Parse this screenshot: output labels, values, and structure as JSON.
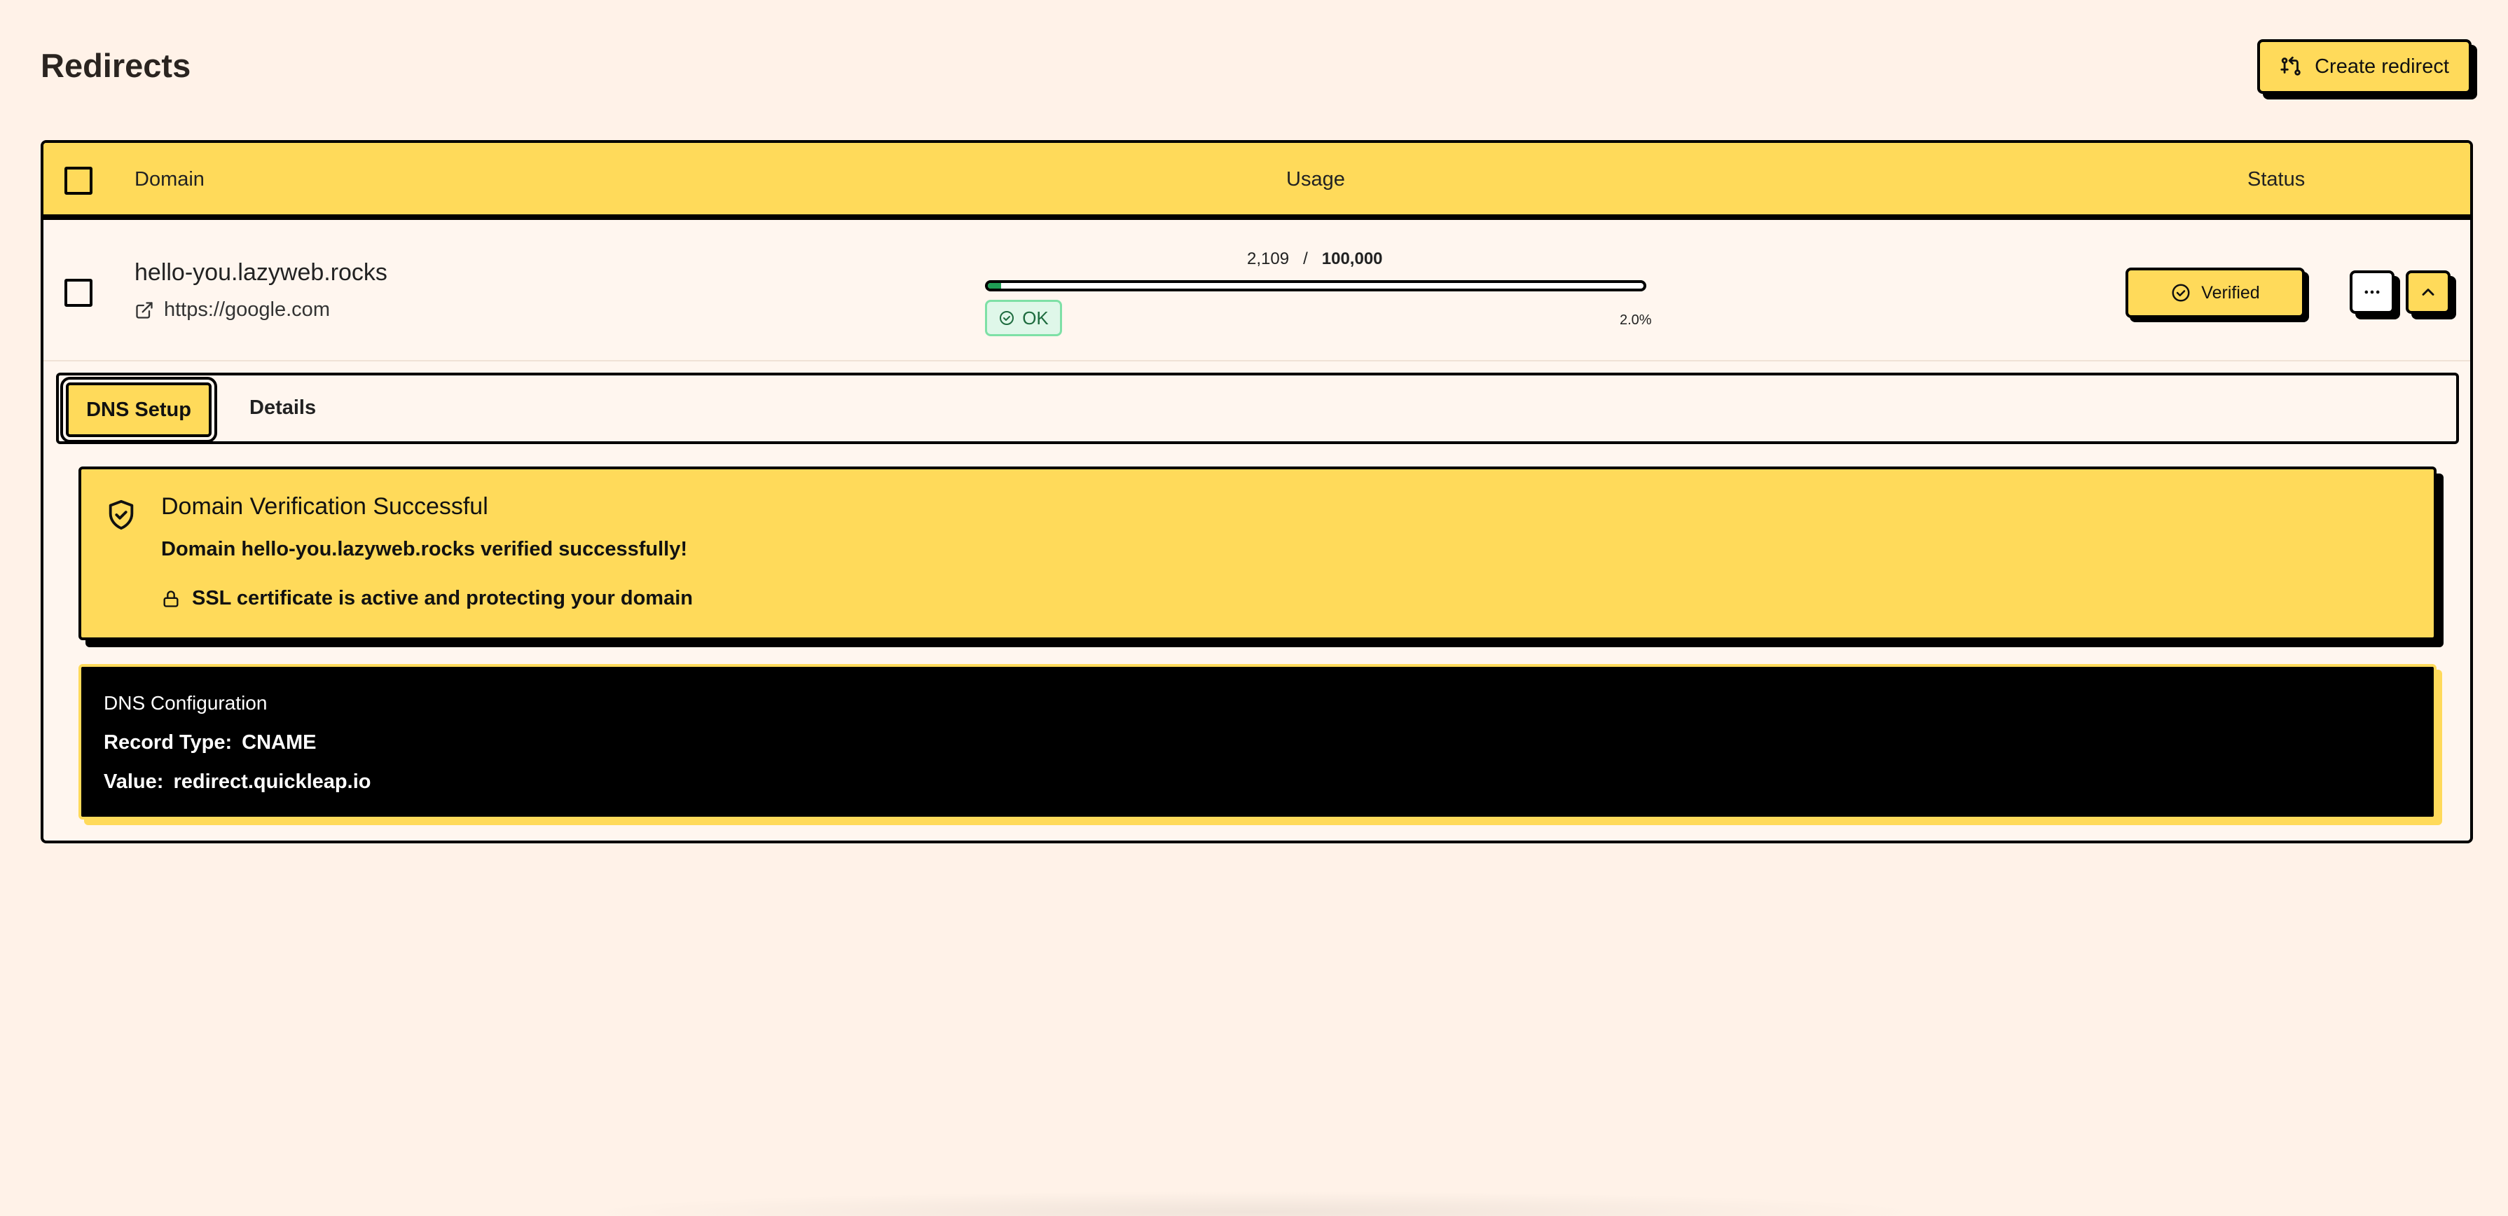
{
  "page": {
    "title": "Redirects"
  },
  "header": {
    "create_button_label": "Create redirect"
  },
  "table": {
    "columns": {
      "domain": "Domain",
      "usage": "Usage",
      "status": "Status"
    },
    "rows": [
      {
        "domain": "hello-you.lazyweb.rocks",
        "target": "https://google.com",
        "usage_used": "2,109",
        "usage_separator": "/",
        "usage_limit": "100,000",
        "usage_fraction": 0.02,
        "usage_percent": "2.0%",
        "usage_status": "OK",
        "status": "Verified"
      }
    ]
  },
  "tabs": {
    "active": "DNS Setup",
    "other": "Details"
  },
  "verification": {
    "title": "Domain Verification Successful",
    "message": "Domain hello-you.lazyweb.rocks verified successfully!",
    "ssl": "SSL certificate is active and protecting your domain"
  },
  "dns": {
    "title": "DNS Configuration",
    "record_type_label": "Record Type:",
    "record_type_value": "CNAME",
    "value_label": "Value:",
    "value_value": "redirect.quickleap.io"
  },
  "colors": {
    "accent": "#ffda5a",
    "background": "#fff2e8",
    "progress": "#1f9d55",
    "ok_badge_bg": "#dff7e9",
    "border": "#000000"
  },
  "icons": {
    "create_redirect": "git-compare-icon",
    "external_link": "external-link-icon",
    "ok": "check-circle-icon",
    "verified": "check-circle-icon",
    "more": "more-horizontal-icon",
    "collapse": "chevron-up-icon",
    "shield": "shield-check-icon",
    "lock": "lock-icon"
  }
}
